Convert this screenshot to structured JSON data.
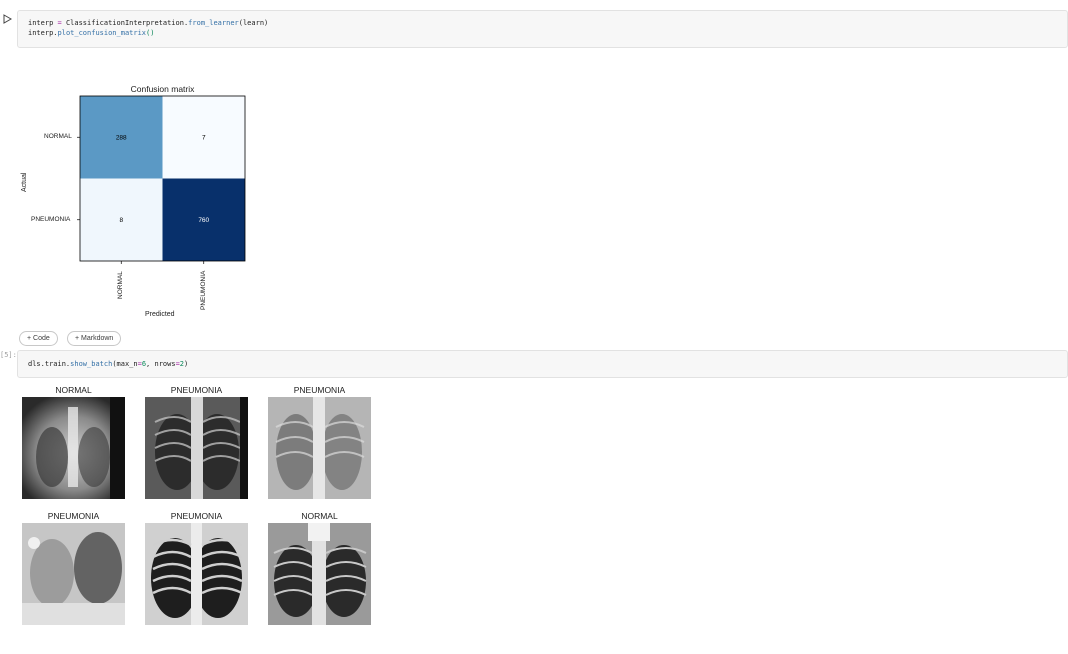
{
  "cell1": {
    "line1": {
      "a": "interp ",
      "op": "=",
      "b": " ClassificationInterpretation.",
      "fn": "from_learner",
      "c": "(learn)"
    },
    "line2": {
      "a": "interp.",
      "fn": "plot_confusion_matrix",
      "c": "()"
    }
  },
  "chart_data": {
    "type": "heatmap",
    "title": "Confusion matrix",
    "xlabel": "Predicted",
    "ylabel": "Actual",
    "x_categories": [
      "NORMAL",
      "PNEUMONIA"
    ],
    "y_categories": [
      "NORMAL",
      "PNEUMONIA"
    ],
    "values": [
      [
        288,
        7
      ],
      [
        8,
        760
      ]
    ],
    "colormap": "Blues",
    "grid": false
  },
  "buttons": {
    "code": "+ Code",
    "markdown": "+ Markdown"
  },
  "cell2": {
    "exec_count": "[5]:",
    "code": {
      "a": "dls.train.",
      "fn": "show_batch",
      "b": "(max_n",
      "op": "=",
      "n1": "6",
      "c": ", nrows",
      "op2": "=",
      "n2": "2",
      "d": ")"
    }
  },
  "batch": {
    "labels": [
      "NORMAL",
      "PNEUMONIA",
      "PNEUMONIA",
      "PNEUMONIA",
      "PNEUMONIA",
      "NORMAL"
    ]
  },
  "colors": {
    "cell_bg": "#f7f7f7",
    "cm_high": "#08306b",
    "cm_mid": "#a9cfe5",
    "cm_low": "#f7fbff"
  }
}
